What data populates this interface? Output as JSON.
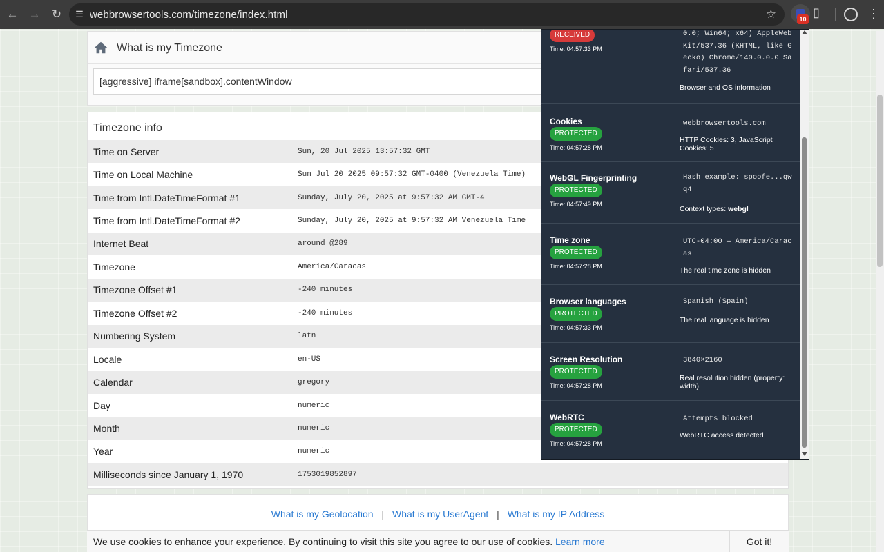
{
  "browser": {
    "url": "webbrowsertools.com/timezone/index.html",
    "extension_badge": "10"
  },
  "header": {
    "title": "What is my Timezone",
    "field_value": "[aggressive] iframe[sandbox].contentWindow"
  },
  "timezone_info": {
    "title": "Timezone info",
    "rows": [
      {
        "label": "Time on Server",
        "value": "Sun, 20 Jul 2025 13:57:32 GMT"
      },
      {
        "label": "Time on Local Machine",
        "value": "Sun Jul 20 2025 09:57:32 GMT-0400 (Venezuela Time)"
      },
      {
        "label": "Time from Intl.DateTimeFormat #1",
        "value": "Sunday, July 20, 2025 at 9:57:32 AM GMT-4"
      },
      {
        "label": "Time from Intl.DateTimeFormat #2",
        "value": "Sunday, July 20, 2025 at 9:57:32 AM Venezuela Time"
      },
      {
        "label": "Internet Beat",
        "value": "around @289"
      },
      {
        "label": "Timezone",
        "value": "America/Caracas"
      },
      {
        "label": "Timezone Offset #1",
        "value": "-240 minutes"
      },
      {
        "label": "Timezone Offset #2",
        "value": "-240 minutes"
      },
      {
        "label": "Numbering System",
        "value": "latn"
      },
      {
        "label": "Locale",
        "value": "en-US"
      },
      {
        "label": "Calendar",
        "value": "gregory"
      },
      {
        "label": "Day",
        "value": "numeric"
      },
      {
        "label": "Month",
        "value": "numeric"
      },
      {
        "label": "Year",
        "value": "numeric"
      },
      {
        "label": "Milliseconds since January 1, 1970",
        "value": "1753019852897"
      }
    ]
  },
  "footer_links": {
    "geolocation": "What is my Geolocation",
    "useragent": "What is my UserAgent",
    "ip": "What is my IP Address",
    "separator": "|"
  },
  "cookie_bar": {
    "text": "We use cookies to enhance your experience. By continuing to visit this site you agree to our use of cookies.",
    "link": "Learn more",
    "button": "Got it!"
  },
  "popup": {
    "items": [
      {
        "name": "",
        "status": "RECEIVED",
        "time": "Time: 04:57:33 PM",
        "code_lines": [
          "0.0; Win64; x64) AppleWeb",
          "Kit/537.36 (KHTML, like G",
          "ecko) Chrome/140.0.0.0 Sa",
          "fari/537.36"
        ],
        "desc": "Browser and OS information"
      },
      {
        "name": "Cookies",
        "status": "PROTECTED",
        "time": "Time: 04:57:28 PM",
        "code_lines": [
          "webbrowsertools.com"
        ],
        "desc": "HTTP Cookies: 3, JavaScript Cookies: 5"
      },
      {
        "name": "WebGL Fingerprinting",
        "status": "PROTECTED",
        "time": "Time: 04:57:49 PM",
        "code_lines": [
          "Hash example: spoofe...qw",
          "q4"
        ],
        "desc_prefix": "Context types: ",
        "desc_bold": "webgl"
      },
      {
        "name": "Time zone",
        "status": "PROTECTED",
        "time": "Time: 04:57:28 PM",
        "code_lines": [
          "UTC-04:00 — America/Carac",
          "as"
        ],
        "desc": "The real time zone is hidden"
      },
      {
        "name": "Browser languages",
        "status": "PROTECTED",
        "time": "Time: 04:57:33 PM",
        "code_lines": [
          "Spanish (Spain)"
        ],
        "desc": "The real language is hidden"
      },
      {
        "name": "Screen Resolution",
        "status": "PROTECTED",
        "time": "Time: 04:57:28 PM",
        "code_lines": [
          "3840×2160"
        ],
        "desc": "Real resolution hidden (property: width)"
      },
      {
        "name": "WebRTC",
        "status": "PROTECTED",
        "time": "Time: 04:57:28 PM",
        "code_lines": [
          "Attempts blocked"
        ],
        "desc": "WebRTC access detected"
      }
    ]
  },
  "icons": {
    "back": "arrow-left",
    "forward": "arrow-right",
    "reload": "reload",
    "site_info": "tune",
    "bookmark": "star",
    "extensions": "puzzle",
    "profile": "account-circle",
    "menu": "more-vertical",
    "home": "home"
  }
}
